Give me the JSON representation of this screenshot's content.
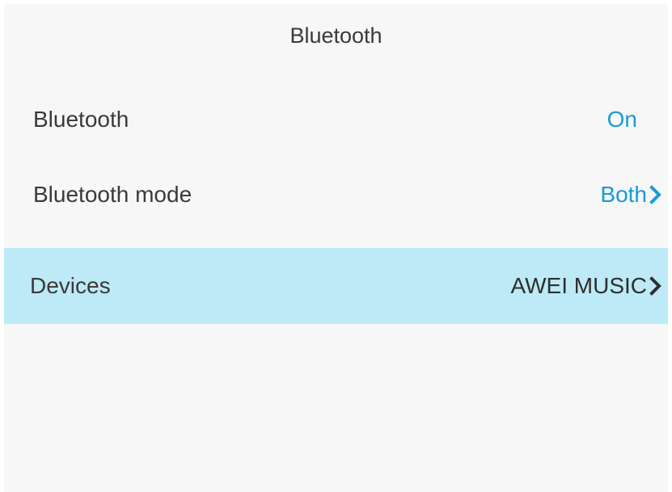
{
  "header": {
    "title": "Bluetooth"
  },
  "settings": {
    "bluetooth": {
      "label": "Bluetooth",
      "value": "On"
    },
    "mode": {
      "label": "Bluetooth mode",
      "value": "Both"
    },
    "devices": {
      "label": "Devices",
      "value": "AWEI MUSIC",
      "selected": true
    }
  },
  "colors": {
    "accent": "#1a9ad6",
    "selection": "#bdeaf6",
    "background": "#f7f7f7",
    "text": "#3a3a3a"
  },
  "icons": {
    "chevron": "chevron-right-icon"
  }
}
